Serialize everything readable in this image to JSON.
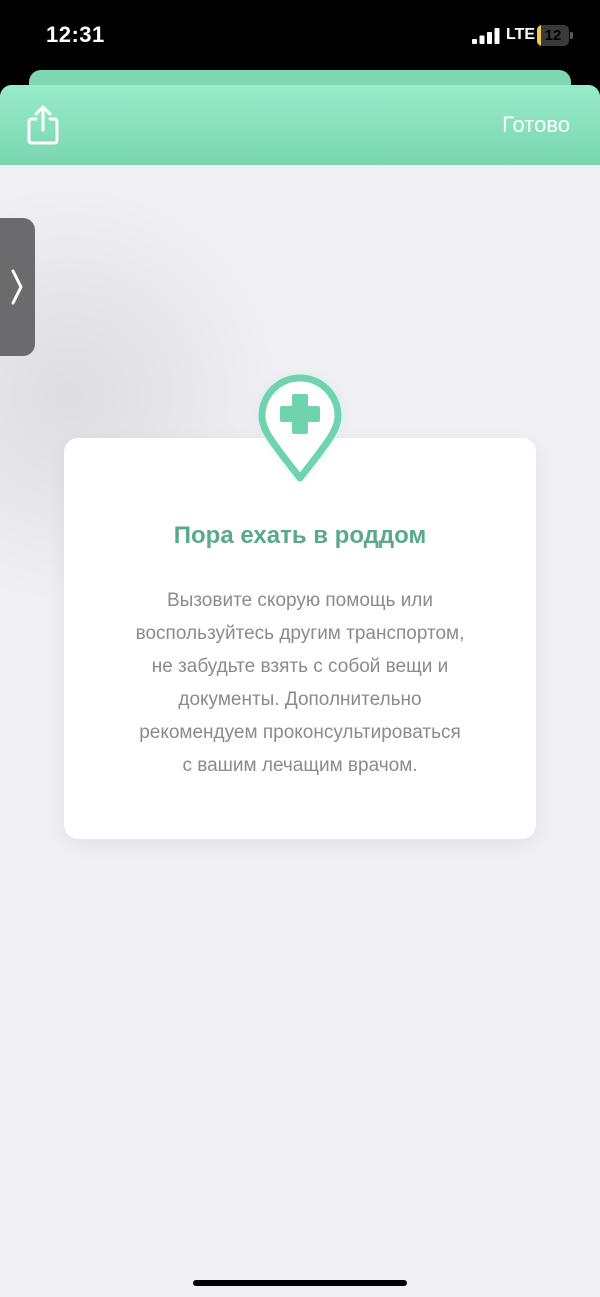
{
  "status_bar": {
    "time": "12:31",
    "network": "LTE",
    "battery_level": "12",
    "battery_fraction": 0.12,
    "signal_icon": "cellular-signal-icon",
    "battery_color": "#f3c94b"
  },
  "header": {
    "share_icon": "share-icon",
    "done_label": "Готово",
    "accent_color": "#79d5b0"
  },
  "side_handle": {
    "icon": "chevron-right-icon"
  },
  "card": {
    "icon": "hospital-location-pin-icon",
    "title": "Пора ехать в роддом",
    "body": "Вызовите скорую помощь или\nвоспользуйтесь другим транспортом,\nне забудьте взять с собой вещи и\nдокументы. Дополнительно\nрекомендуем проконсультироваться\nс вашим лечащим врачом.",
    "title_color": "#5aa98a",
    "icon_color": "#6fd3ae"
  }
}
